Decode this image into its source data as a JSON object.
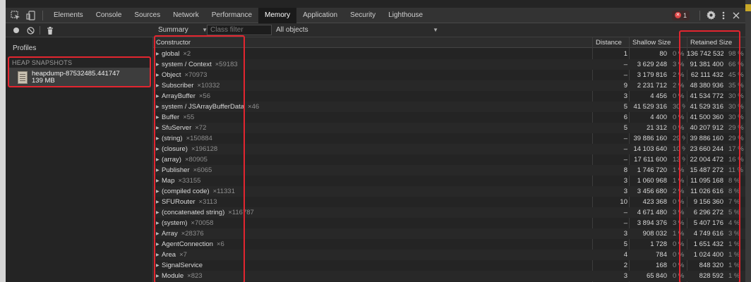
{
  "tabs": [
    "Elements",
    "Console",
    "Sources",
    "Network",
    "Performance",
    "Memory",
    "Application",
    "Security",
    "Lighthouse"
  ],
  "active_tab": "Memory",
  "error_count": "1",
  "toolbar": {
    "view": "Summary",
    "class_filter_placeholder": "Class filter",
    "objects_filter": "All objects"
  },
  "sidebar": {
    "title": "Profiles",
    "section": "HEAP SNAPSHOTS",
    "snapshot_name": "heapdump-87532485.441747",
    "snapshot_size": "139 MB"
  },
  "table": {
    "columns": [
      "Constructor",
      "Distance",
      "Shallow Size",
      "Retained Size"
    ],
    "rows": [
      {
        "name": "global",
        "count": "×2",
        "distance": "1",
        "shallow": "80",
        "shallow_pct": "0 %",
        "retained": "136 742 532",
        "retained_pct": "98 %"
      },
      {
        "name": "system / Context",
        "count": "×59183",
        "distance": "–",
        "shallow": "3 629 248",
        "shallow_pct": "3 %",
        "retained": "91 381 400",
        "retained_pct": "66 %"
      },
      {
        "name": "Object",
        "count": "×70973",
        "distance": "–",
        "shallow": "3 179 816",
        "shallow_pct": "2 %",
        "retained": "62 111 432",
        "retained_pct": "45 %"
      },
      {
        "name": "Subscriber",
        "count": "×10332",
        "distance": "9",
        "shallow": "2 231 712",
        "shallow_pct": "2 %",
        "retained": "48 380 936",
        "retained_pct": "35 %"
      },
      {
        "name": "ArrayBuffer",
        "count": "×56",
        "distance": "3",
        "shallow": "4 456",
        "shallow_pct": "0 %",
        "retained": "41 534 772",
        "retained_pct": "30 %"
      },
      {
        "name": "system / JSArrayBufferData",
        "count": "×46",
        "distance": "5",
        "shallow": "41 529 316",
        "shallow_pct": "30 %",
        "retained": "41 529 316",
        "retained_pct": "30 %"
      },
      {
        "name": "Buffer",
        "count": "×55",
        "distance": "6",
        "shallow": "4 400",
        "shallow_pct": "0 %",
        "retained": "41 500 360",
        "retained_pct": "30 %"
      },
      {
        "name": "SfuServer",
        "count": "×72",
        "distance": "5",
        "shallow": "21 312",
        "shallow_pct": "0 %",
        "retained": "40 207 912",
        "retained_pct": "29 %"
      },
      {
        "name": "(string)",
        "count": "×150884",
        "distance": "–",
        "shallow": "39 886 160",
        "shallow_pct": "29 %",
        "retained": "39 886 160",
        "retained_pct": "29 %"
      },
      {
        "name": "(closure)",
        "count": "×196128",
        "distance": "–",
        "shallow": "14 103 640",
        "shallow_pct": "10 %",
        "retained": "23 660 244",
        "retained_pct": "17 %"
      },
      {
        "name": "(array)",
        "count": "×80905",
        "distance": "–",
        "shallow": "17 611 600",
        "shallow_pct": "13 %",
        "retained": "22 004 472",
        "retained_pct": "16 %"
      },
      {
        "name": "Publisher",
        "count": "×6065",
        "distance": "8",
        "shallow": "1 746 720",
        "shallow_pct": "1 %",
        "retained": "15 487 272",
        "retained_pct": "11 %"
      },
      {
        "name": "Map",
        "count": "×33155",
        "distance": "3",
        "shallow": "1 060 968",
        "shallow_pct": "1 %",
        "retained": "11 095 168",
        "retained_pct": "8 %"
      },
      {
        "name": "(compiled code)",
        "count": "×11331",
        "distance": "3",
        "shallow": "3 456 680",
        "shallow_pct": "2 %",
        "retained": "11 026 616",
        "retained_pct": "8 %"
      },
      {
        "name": "SFURouter",
        "count": "×3113",
        "distance": "10",
        "shallow": "423 368",
        "shallow_pct": "0 %",
        "retained": "9 156 360",
        "retained_pct": "7 %"
      },
      {
        "name": "(concatenated string)",
        "count": "×116787",
        "distance": "–",
        "shallow": "4 671 480",
        "shallow_pct": "3 %",
        "retained": "6 296 272",
        "retained_pct": "5 %"
      },
      {
        "name": "(system)",
        "count": "×70058",
        "distance": "–",
        "shallow": "3 894 376",
        "shallow_pct": "3 %",
        "retained": "5 407 176",
        "retained_pct": "4 %"
      },
      {
        "name": "Array",
        "count": "×28376",
        "distance": "3",
        "shallow": "908 032",
        "shallow_pct": "1 %",
        "retained": "4 749 616",
        "retained_pct": "3 %"
      },
      {
        "name": "AgentConnection",
        "count": "×6",
        "distance": "5",
        "shallow": "1 728",
        "shallow_pct": "0 %",
        "retained": "1 651 432",
        "retained_pct": "1 %"
      },
      {
        "name": "Area",
        "count": "×7",
        "distance": "4",
        "shallow": "784",
        "shallow_pct": "0 %",
        "retained": "1 024 400",
        "retained_pct": "1 %"
      },
      {
        "name": "SignalService",
        "count": "",
        "distance": "2",
        "shallow": "168",
        "shallow_pct": "0 %",
        "retained": "848 320",
        "retained_pct": "1 %"
      },
      {
        "name": "Module",
        "count": "×823",
        "distance": "3",
        "shallow": "65 840",
        "shallow_pct": "0 %",
        "retained": "828 592",
        "retained_pct": "1 %"
      }
    ]
  },
  "colors": {
    "highlight": "#e3252f",
    "active_tab_bg": "#1a1a1a",
    "error": "#e04646"
  }
}
